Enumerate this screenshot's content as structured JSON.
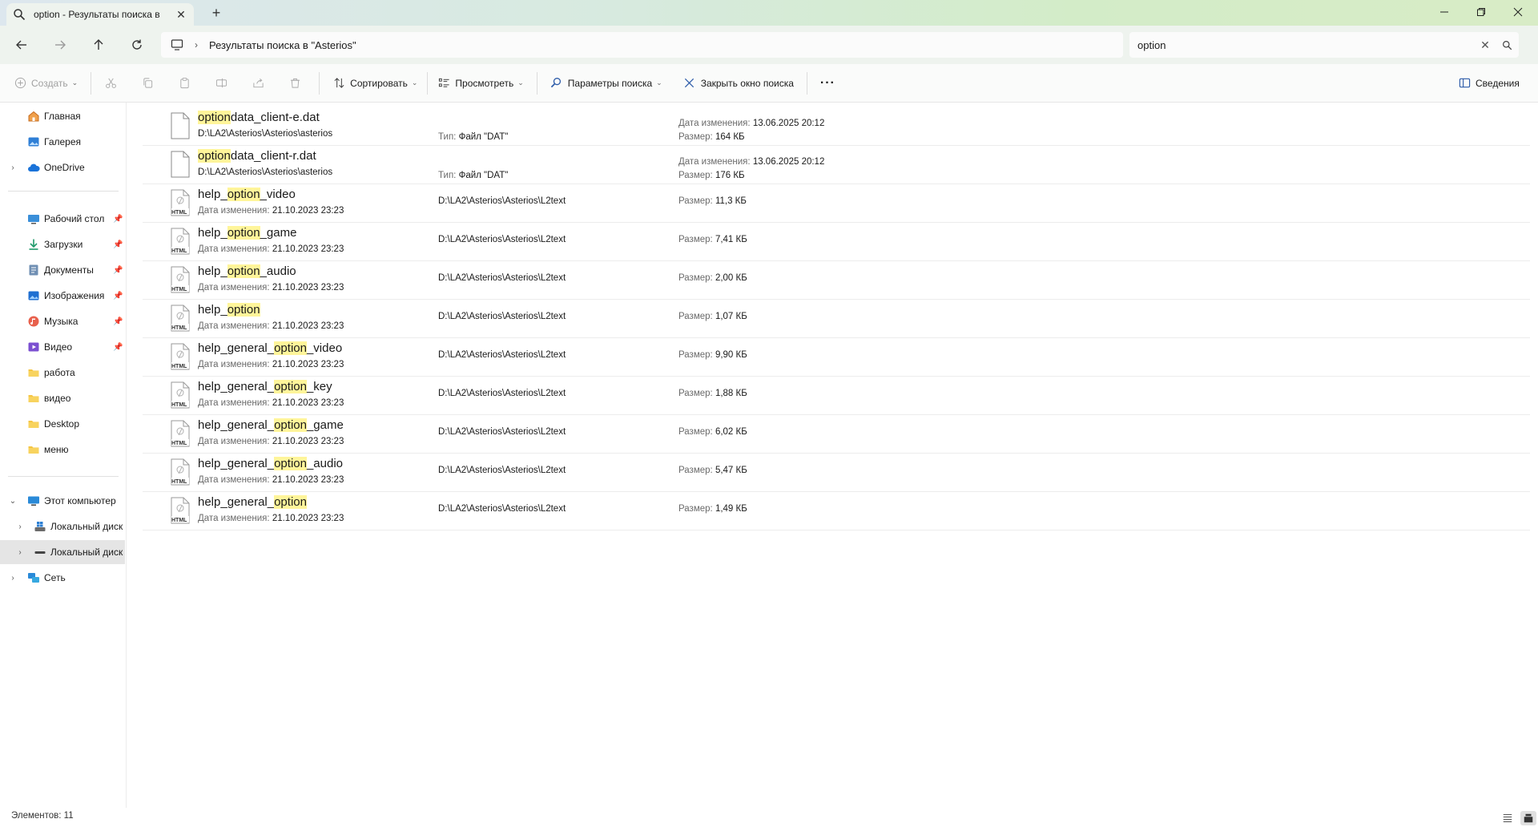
{
  "tab": {
    "title": "option - Результаты поиска в",
    "close_symbol": "✕",
    "new_symbol": "+"
  },
  "address": {
    "breadcrumb": "Результаты поиска в \"Asterios\""
  },
  "search": {
    "value": "option"
  },
  "toolbar": {
    "create": "Создать",
    "sort": "Сортировать",
    "view": "Просмотреть",
    "search_options": "Параметры поиска",
    "close_search": "Закрыть окно поиска",
    "more": "···",
    "details": "Сведения"
  },
  "sidebar": {
    "items": [
      {
        "label": "Главная"
      },
      {
        "label": "Галерея"
      },
      {
        "label": "OneDrive"
      },
      {
        "label": "Рабочий стол"
      },
      {
        "label": "Загрузки"
      },
      {
        "label": "Документы"
      },
      {
        "label": "Изображения"
      },
      {
        "label": "Музыка"
      },
      {
        "label": "Видео"
      },
      {
        "label": "работа"
      },
      {
        "label": "видео"
      },
      {
        "label": "Desktop"
      },
      {
        "label": "меню"
      },
      {
        "label": "Этот компьютер"
      },
      {
        "label": "Локальный диск"
      },
      {
        "label": "Локальный диск"
      },
      {
        "label": "Сеть"
      }
    ]
  },
  "labels": {
    "modified": "Дата изменения:",
    "type": "Тип:",
    "size": "Размер:"
  },
  "files": [
    {
      "pre": "",
      "hl": "option",
      "post": "data_client-e.dat",
      "kind": "dat",
      "path": "D:\\LA2\\Asterios\\Asterios\\asterios",
      "type": "Файл \"DAT\"",
      "modified": "13.06.2025 20:12",
      "size": "164 КБ"
    },
    {
      "pre": "",
      "hl": "option",
      "post": "data_client-r.dat",
      "kind": "dat",
      "path": "D:\\LA2\\Asterios\\Asterios\\asterios",
      "type": "Файл \"DAT\"",
      "modified": "13.06.2025 20:12",
      "size": "176 КБ"
    },
    {
      "pre": "help_",
      "hl": "option",
      "post": "_video",
      "kind": "html",
      "path": "D:\\LA2\\Asterios\\Asterios\\L2text",
      "modified": "21.10.2023 23:23",
      "size": "11,3 КБ"
    },
    {
      "pre": "help_",
      "hl": "option",
      "post": "_game",
      "kind": "html",
      "path": "D:\\LA2\\Asterios\\Asterios\\L2text",
      "modified": "21.10.2023 23:23",
      "size": "7,41 КБ"
    },
    {
      "pre": "help_",
      "hl": "option",
      "post": "_audio",
      "kind": "html",
      "path": "D:\\LA2\\Asterios\\Asterios\\L2text",
      "modified": "21.10.2023 23:23",
      "size": "2,00 КБ"
    },
    {
      "pre": "help_",
      "hl": "option",
      "post": "",
      "kind": "html",
      "path": "D:\\LA2\\Asterios\\Asterios\\L2text",
      "modified": "21.10.2023 23:23",
      "size": "1,07 КБ"
    },
    {
      "pre": "help_general_",
      "hl": "option",
      "post": "_video",
      "kind": "html",
      "path": "D:\\LA2\\Asterios\\Asterios\\L2text",
      "modified": "21.10.2023 23:23",
      "size": "9,90 КБ"
    },
    {
      "pre": "help_general_",
      "hl": "option",
      "post": "_key",
      "kind": "html",
      "path": "D:\\LA2\\Asterios\\Asterios\\L2text",
      "modified": "21.10.2023 23:23",
      "size": "1,88 КБ"
    },
    {
      "pre": "help_general_",
      "hl": "option",
      "post": "_game",
      "kind": "html",
      "path": "D:\\LA2\\Asterios\\Asterios\\L2text",
      "modified": "21.10.2023 23:23",
      "size": "6,02 КБ"
    },
    {
      "pre": "help_general_",
      "hl": "option",
      "post": "_audio",
      "kind": "html",
      "path": "D:\\LA2\\Asterios\\Asterios\\L2text",
      "modified": "21.10.2023 23:23",
      "size": "5,47 КБ"
    },
    {
      "pre": "help_general_",
      "hl": "option",
      "post": "",
      "kind": "html",
      "path": "D:\\LA2\\Asterios\\Asterios\\L2text",
      "modified": "21.10.2023 23:23",
      "size": "1,49 КБ"
    }
  ],
  "status": {
    "count": "Элементов: 11"
  },
  "html_badge": "HTML"
}
